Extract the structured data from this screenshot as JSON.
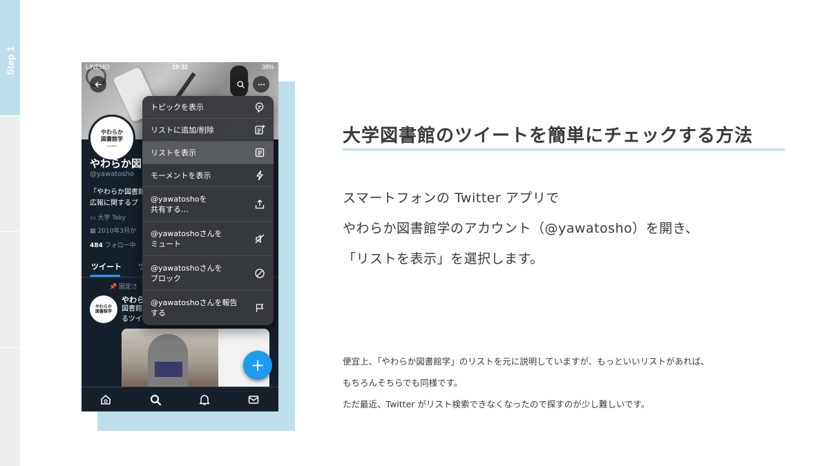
{
  "step": {
    "label": "Step 1"
  },
  "phone": {
    "status": {
      "carrier": "LINEMO",
      "time": "19:32",
      "battery": "38%"
    },
    "profile": {
      "avatar_lines": [
        "やわらか",
        "図書館学"
      ],
      "name": "やわらか図",
      "handle": "@yawatosho",
      "bio_lines": [
        "「やわらか図書館",
        "広報に関するプ"
      ],
      "meta_location_line": "大学  Toky",
      "meta_joined": "2010年3月か",
      "following_count": "484",
      "following_label": "フォロー中"
    },
    "tabs": [
      {
        "label": "ツイート"
      },
      {
        "label": "ツ"
      }
    ],
    "pinned_label": "固定さ",
    "tweet": {
      "avatar_lines": [
        "やわらか",
        "図書館学"
      ],
      "name": "やわら",
      "text_lines": [
        "図書館",
        "るツイ"
      ]
    },
    "fab_icon": "plus-icon",
    "bottom_nav": [
      "home-icon",
      "search-icon",
      "bell-icon",
      "mail-icon"
    ]
  },
  "menu": {
    "items": [
      {
        "label": "トピックを表示",
        "icon": "topic-icon",
        "highlighted": false
      },
      {
        "label": "リストに追加/削除",
        "icon": "list-add-icon",
        "highlighted": false
      },
      {
        "label": "リストを表示",
        "icon": "list-icon",
        "highlighted": true
      },
      {
        "label": "モーメントを表示",
        "icon": "lightning-icon",
        "highlighted": false
      },
      {
        "label": "@yawatoshoを\n共有する…",
        "icon": "share-icon",
        "highlighted": false
      },
      {
        "label": "@yawatoshoさんを\nミュート",
        "icon": "mute-icon",
        "highlighted": false
      },
      {
        "label": "@yawatoshoさんを\nブロック",
        "icon": "block-icon",
        "highlighted": false
      },
      {
        "label": "@yawatoshoさんを報告\nする",
        "icon": "flag-icon",
        "highlighted": false
      }
    ]
  },
  "content": {
    "title": "大学図書館のツイートを簡単にチェックする方法",
    "lead": [
      "スマートフォンの Twitter アプリで",
      "やわらか図書館学のアカウント（@yawatosho）を開き、",
      "「リストを表示」を選択します。"
    ],
    "note": [
      "便宜上、「やわらか図書館学」のリストを元に説明していますが、もっといいリストがあれば、",
      "もちろんそちらでも同様です。",
      "ただ最近、Twitter がリスト検索できなくなったので探すのが少し難しいです。"
    ]
  },
  "colors": {
    "accent": "#bcdfe9",
    "rail": "#efefef",
    "twitter_blue": "#1d9bf0",
    "app_bg": "#15202b"
  }
}
